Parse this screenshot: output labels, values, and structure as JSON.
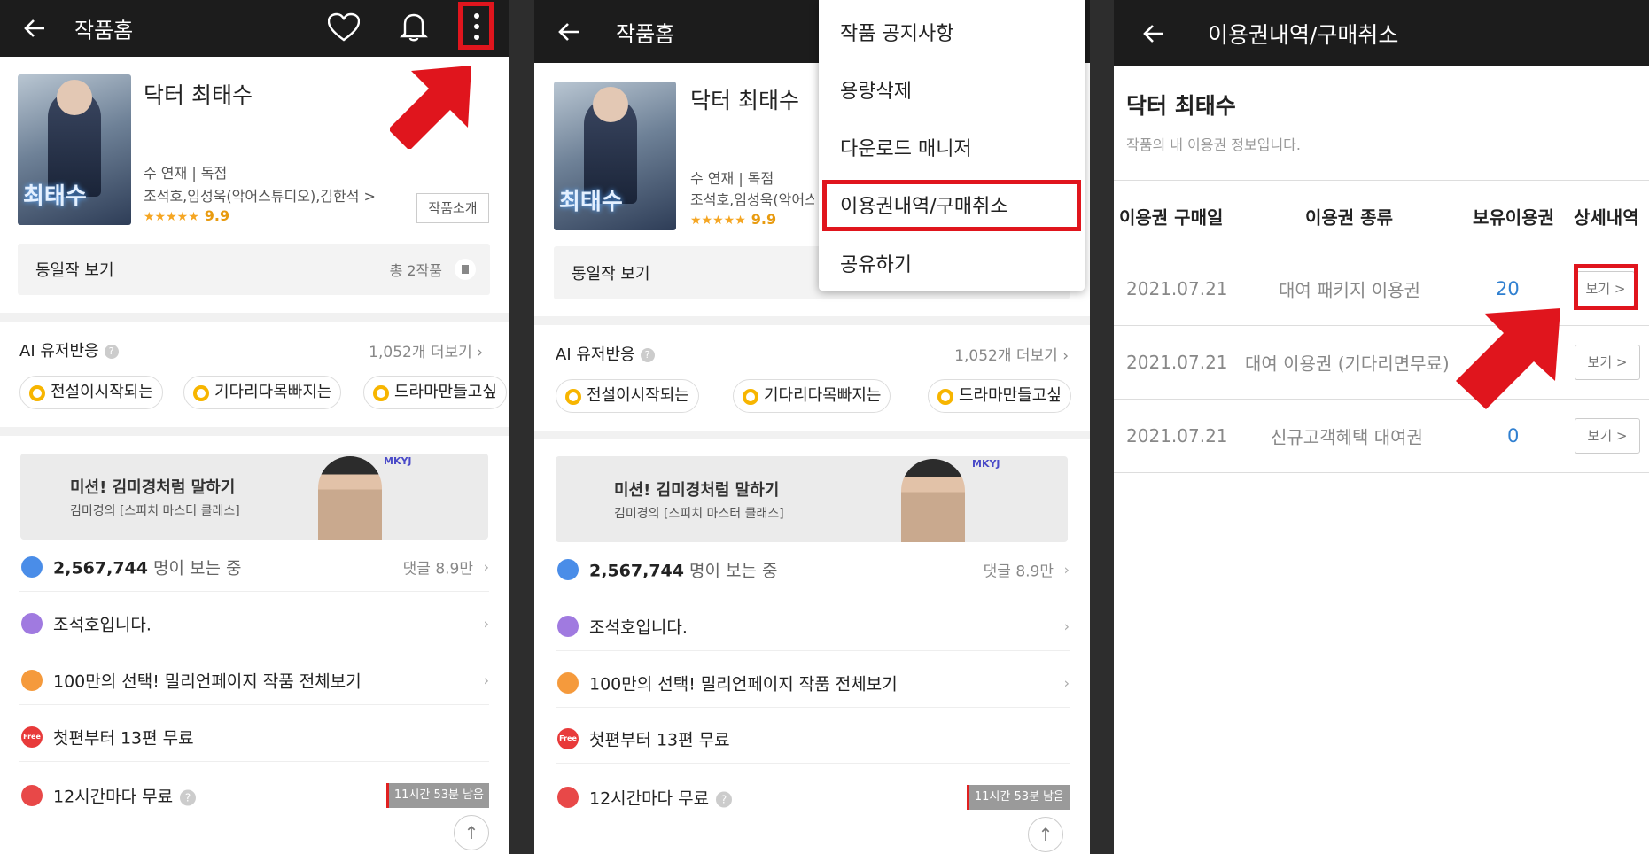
{
  "colors": {
    "topbar": "#1c1c1c",
    "accent_red": "#e0151d",
    "star": "#f5a623",
    "link_blue": "#2f7fd0"
  },
  "panel1": {
    "header": {
      "title": "작품홈",
      "icons": [
        "back-arrow-icon",
        "heart-icon",
        "bell-icon",
        "more-vertical-icon"
      ]
    },
    "work": {
      "cover_text": "최태수",
      "title": "닥터 최태수",
      "tags": "수 연재 | 독점",
      "authors": "조석호,임성욱(악어스튜디오),김한석 >",
      "stars": "★★★★★",
      "rating": "9.9",
      "intro_button": "작품소개"
    },
    "same_works": {
      "label": "동일작 보기",
      "count": "총 2작품"
    },
    "ai": {
      "label": "AI 유저반응",
      "more": "1,052개 더보기",
      "chips": [
        "전설이시작되는",
        "기다리다목빠지는",
        "드라마만들고싶"
      ]
    },
    "ad": {
      "title": "미션! 김미경처럼 말하기",
      "subtitle": "김미경의 [스피치 마스터 클래스]",
      "logo": "MKYJ"
    },
    "rows": {
      "viewers_count": "2,567,744",
      "viewers_suffix": "명이 보는 중",
      "comments": "댓글 8.9만",
      "notice": "조석호입니다.",
      "promo": "100만의 선택! 밀리언페이지 작품 전체보기",
      "free": "첫편부터 13편 무료",
      "free_badge": "Free",
      "timer": "12시간마다 무료",
      "timer_badge": "11시간 53분 남음"
    }
  },
  "panel2": {
    "header": {
      "title": "작품홈"
    },
    "menu": [
      "작품 공지사항",
      "용량삭제",
      "다운로드 매니저",
      "이용권내역/구매취소",
      "공유하기"
    ]
  },
  "panel3": {
    "header": {
      "title": "이용권내역/구매취소"
    },
    "work_title": "닥터 최태수",
    "subtitle": "작품의 내 이용권 정보입니다.",
    "columns": [
      "이용권 구매일",
      "이용권 종류",
      "보유이용권",
      "상세내역"
    ],
    "rows": [
      {
        "date": "2021.07.21",
        "type": "대여 패키지 이용권",
        "owned": "20",
        "detail": "보기 >"
      },
      {
        "date": "2021.07.21",
        "type": "대여 이용권 (기다리면무료)",
        "owned": "",
        "detail": "보기 >"
      },
      {
        "date": "2021.07.21",
        "type": "신규고객혜택 대여권",
        "owned": "0",
        "detail": "보기 >"
      }
    ]
  }
}
